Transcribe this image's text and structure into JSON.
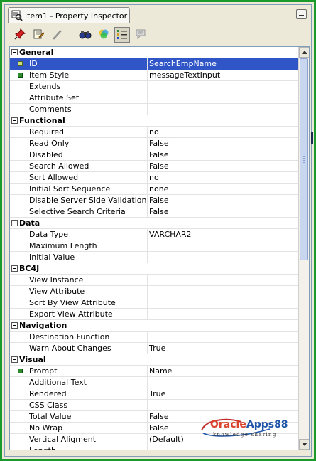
{
  "window": {
    "tab_title": "item1 - Property Inspector"
  },
  "toolbar": {
    "buttons": [
      {
        "name": "pin-icon",
        "active": false
      },
      {
        "name": "edit-document-icon",
        "active": false
      },
      {
        "name": "pencil-icon",
        "active": false
      },
      {
        "name": "binoculars-icon",
        "active": false
      },
      {
        "name": "color-wheel-icon",
        "active": false
      },
      {
        "name": "categorized-view-icon",
        "active": true
      },
      {
        "name": "comment-icon",
        "active": false
      }
    ]
  },
  "sections": [
    {
      "title": "General",
      "rows": [
        {
          "name": "ID",
          "value": "SearchEmpName",
          "marker": true,
          "selected": true
        },
        {
          "name": "Item Style",
          "value": "messageTextInput",
          "marker": true
        },
        {
          "name": "Extends",
          "value": ""
        },
        {
          "name": "Attribute Set",
          "value": ""
        },
        {
          "name": "Comments",
          "value": ""
        }
      ]
    },
    {
      "title": "Functional",
      "rows": [
        {
          "name": "Required",
          "value": "no"
        },
        {
          "name": "Read Only",
          "value": "False"
        },
        {
          "name": "Disabled",
          "value": "False"
        },
        {
          "name": "Search Allowed",
          "value": "False"
        },
        {
          "name": "Sort Allowed",
          "value": "no"
        },
        {
          "name": "Initial Sort Sequence",
          "value": "none"
        },
        {
          "name": "Disable Server Side Validation",
          "value": "False"
        },
        {
          "name": "Selective Search Criteria",
          "value": "False"
        }
      ]
    },
    {
      "title": "Data",
      "rows": [
        {
          "name": "Data Type",
          "value": "VARCHAR2"
        },
        {
          "name": "Maximum Length",
          "value": ""
        },
        {
          "name": "Initial Value",
          "value": ""
        }
      ]
    },
    {
      "title": "BC4J",
      "rows": [
        {
          "name": "View Instance",
          "value": ""
        },
        {
          "name": "View Attribute",
          "value": ""
        },
        {
          "name": "Sort By View Attribute",
          "value": ""
        },
        {
          "name": "Export View Attribute",
          "value": ""
        }
      ]
    },
    {
      "title": "Navigation",
      "rows": [
        {
          "name": "Destination Function",
          "value": ""
        },
        {
          "name": "Warn About Changes",
          "value": "True"
        }
      ]
    },
    {
      "title": "Visual",
      "rows": [
        {
          "name": "Prompt",
          "value": "Name",
          "marker": true
        },
        {
          "name": "Additional Text",
          "value": ""
        },
        {
          "name": "Rendered",
          "value": "True"
        },
        {
          "name": "CSS Class",
          "value": ""
        },
        {
          "name": "Total Value",
          "value": "False"
        },
        {
          "name": "No Wrap",
          "value": "False"
        },
        {
          "name": "Vertical Aligment",
          "value": "(Default)"
        },
        {
          "name": "Length",
          "value": ""
        }
      ]
    }
  ],
  "watermark": {
    "brand_part1": "Oracle",
    "brand_part2": "Apps88",
    "tagline": "knowledge sharing"
  },
  "colors": {
    "frame_border": "#1a9a2a",
    "selection": "#2f55c6",
    "marker": "#2e8b2e"
  }
}
